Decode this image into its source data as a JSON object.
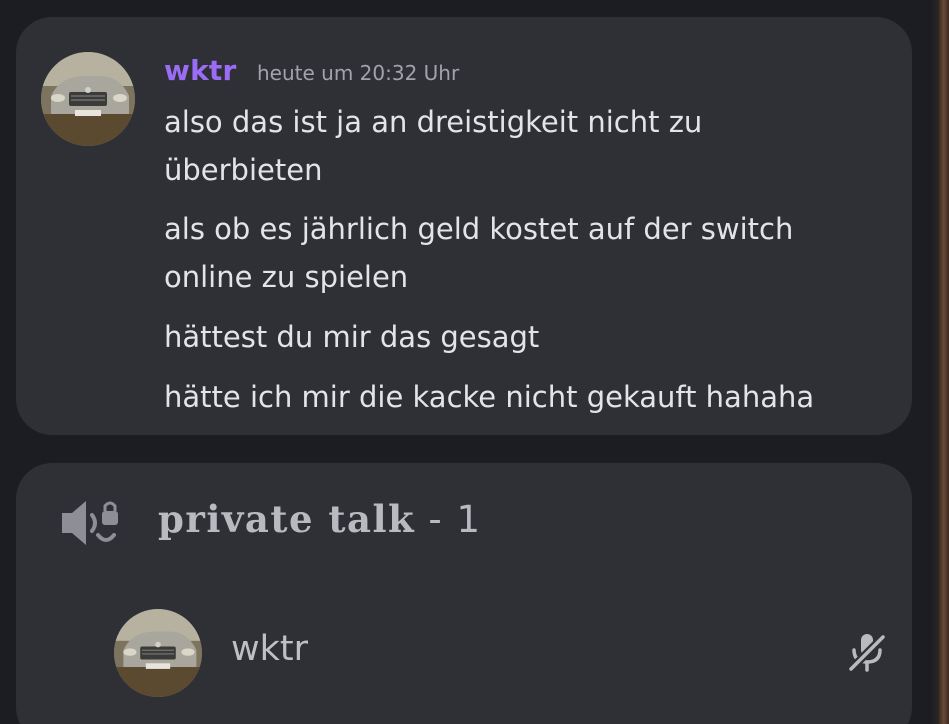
{
  "message": {
    "author": "wktr",
    "timestamp": "heute um 20:32 Uhr",
    "author_color": "#9b6cf5",
    "lines": [
      "also das ist ja an dreistigkeit nicht zu\nüberbieten",
      "als ob es jährlich geld kostet auf der switch\nonline zu spielen",
      "hättest du mir das gesagt",
      "hätte ich mir die kacke nicht gekauft hahaha"
    ]
  },
  "voice_channel": {
    "icon": "speaker-lock-icon",
    "name": "private talk",
    "name_suffix": " - 1",
    "members": [
      {
        "name": "wktr",
        "status_icon": "muted-microphone-icon"
      }
    ]
  },
  "colors": {
    "background": "#1c1d22",
    "card": "#2f3036",
    "text": "#e3e4e8",
    "muted_text": "#a2a3aa"
  }
}
